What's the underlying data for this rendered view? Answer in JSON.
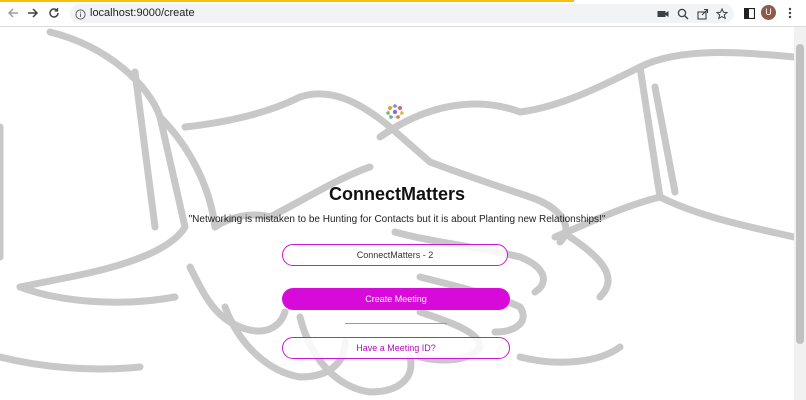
{
  "browser": {
    "url": "localhost:9000/create",
    "profile_initial": "U",
    "icons": [
      "back-icon",
      "forward-icon",
      "reload-icon",
      "info-icon",
      "camera-icon",
      "zoom-icon",
      "share-icon",
      "star-icon",
      "sidebar-icon",
      "more-icon"
    ]
  },
  "page": {
    "title": "ConnectMatters",
    "quote": "\"Networking is mistaken to be Hunting for Contacts but it is about Planting new Relationships!\"",
    "meeting_name": {
      "value": "ConnectMatters - 2"
    },
    "create_button_label": "Create Meeting",
    "meeting_id_button_label": "Have a Meeting ID?",
    "colors": {
      "accent": "#d80ad9",
      "border": "#c917d8",
      "background_art": "#c8c8c8"
    }
  }
}
